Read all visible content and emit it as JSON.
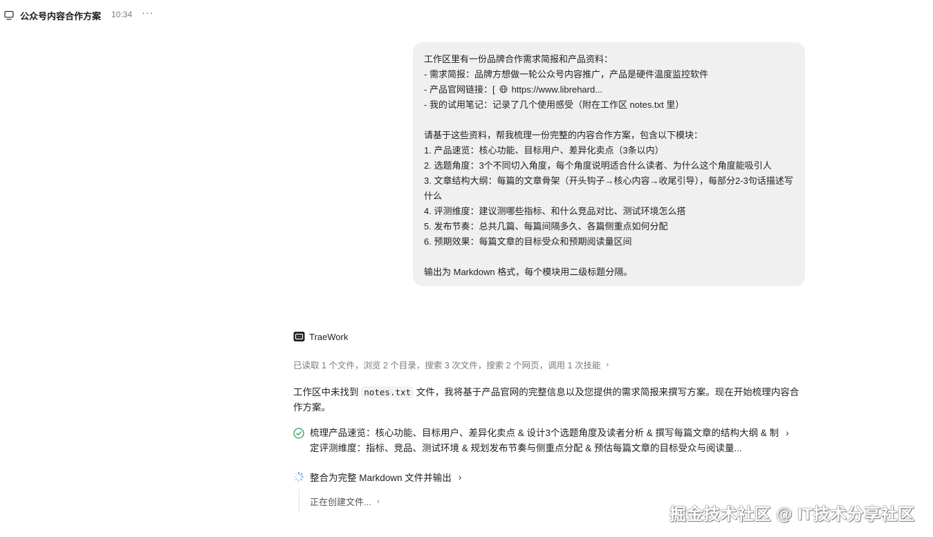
{
  "header": {
    "title": "公众号内容合作方案",
    "time": "10:34",
    "more": "···"
  },
  "user_message": {
    "lines": [
      "工作区里有一份品牌合作需求简报和产品资料：",
      "- 需求简报：品牌方想做一轮公众号内容推广，产品是硬件温度监控软件",
      "- 产品官网链接：[",
      "- 我的试用笔记：记录了几个使用感受（附在工作区 notes.txt 里）",
      "请基于这些资料，帮我梳理一份完整的内容合作方案，包含以下模块：",
      "1. 产品速览：核心功能、目标用户、差异化卖点（3条以内）",
      "2. 选题角度：3个不同切入角度，每个角度说明适合什么读者、为什么这个角度能吸引人",
      "3. 文章结构大纲：每篇的文章骨架（开头钩子→核心内容→收尾引导），每部分2-3句话描述写什么",
      "4. 评测维度：建议测哪些指标、和什么竞品对比、测试环境怎么搭",
      "5. 发布节奏：总共几篇、每篇间隔多久、各篇侧重点如何分配",
      "6. 预期效果：每篇文章的目标受众和预期阅读量区间",
      "输出为 Markdown 格式，每个模块用二级标题分隔。"
    ],
    "link_text": "https://www.librehard..."
  },
  "assistant": {
    "name": "TraeWork",
    "activity": "已读取 1 个文件，浏览 2 个目录，搜索 3 次文件，搜索 2 个网页，调用 1 次技能",
    "reply_before": "工作区中未找到 ",
    "reply_code": "notes.txt",
    "reply_after": " 文件，我将基于产品官网的完整信息以及您提供的需求简报来撰写方案。现在开始梳理内容合作方案。",
    "task1": "梳理产品速览：核心功能、目标用户、差异化卖点 & 设计3个选题角度及读者分析 & 撰写每篇文章的结构大纲 & 制定评测维度：指标、竞品、测试环境 & 规划发布节奏与侧重点分配 & 预估每篇文章的目标受众与阅读量...",
    "task2": "整合为完整 Markdown 文件并输出",
    "subtask": "正在创建文件..."
  },
  "watermark": "掘金技术社区 @ IT技术分享社区",
  "icons": {
    "chat": "chat-bubble-icon",
    "globe": "globe-icon",
    "logo": "traework-logo-icon",
    "check": "check-circle-icon",
    "spinner": "loading-spinner-icon",
    "chevron": "chevron-right-icon"
  }
}
